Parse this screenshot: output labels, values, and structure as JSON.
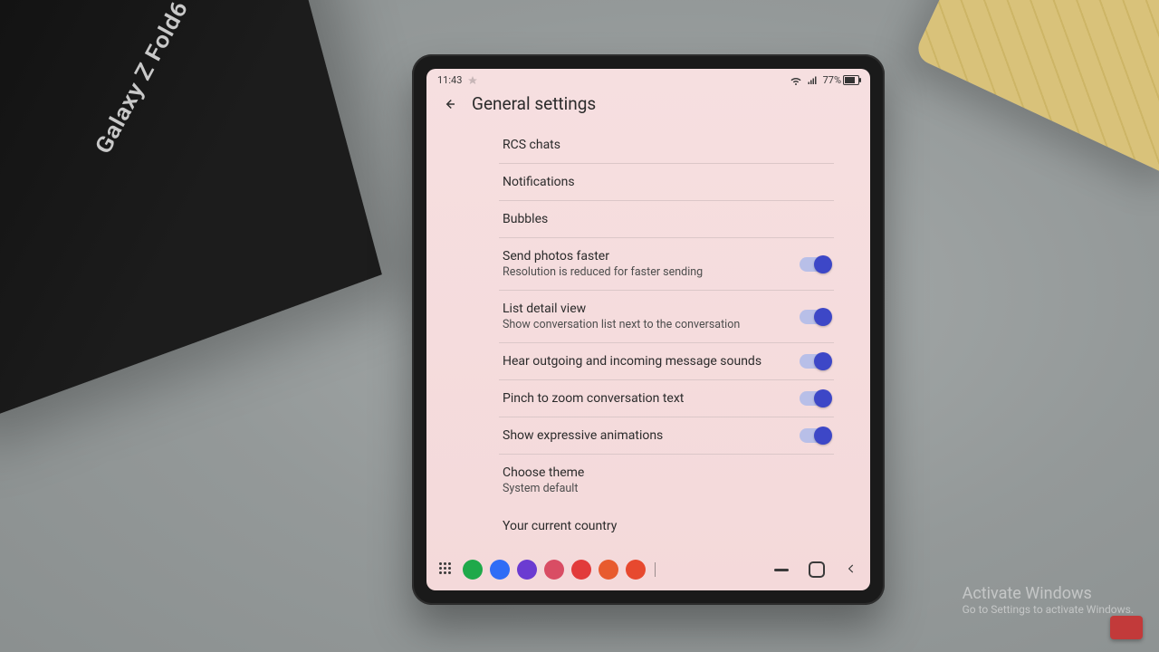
{
  "statusbar": {
    "time": "11:43",
    "battery": "77%"
  },
  "header": {
    "title": "General settings"
  },
  "settings": {
    "rcs": {
      "label": "RCS chats"
    },
    "notifications": {
      "label": "Notifications"
    },
    "bubbles": {
      "label": "Bubbles"
    },
    "send_photos": {
      "label": "Send photos faster",
      "sub": "Resolution is reduced for faster sending"
    },
    "list_detail": {
      "label": "List detail view",
      "sub": "Show conversation list next to the conversation"
    },
    "sounds": {
      "label": "Hear outgoing and incoming message sounds"
    },
    "pinch_zoom": {
      "label": "Pinch to zoom conversation text"
    },
    "expressive": {
      "label": "Show expressive animations"
    },
    "theme": {
      "label": "Choose theme",
      "sub": "System default"
    },
    "country": {
      "label": "Your current country"
    }
  },
  "watermark": {
    "line1": "Activate Windows",
    "line2": "Go to Settings to activate Windows."
  },
  "taskbar": {
    "apps": [
      {
        "name": "phone",
        "bg": "#1fa94a"
      },
      {
        "name": "messages",
        "bg": "#2f6df6"
      },
      {
        "name": "viber",
        "bg": "#6b3bd1"
      },
      {
        "name": "app4",
        "bg": "#d94d64"
      },
      {
        "name": "youtube",
        "bg": "#e23b3b"
      },
      {
        "name": "app6",
        "bg": "#e85b2e"
      },
      {
        "name": "app7",
        "bg": "#e7492f"
      }
    ]
  }
}
